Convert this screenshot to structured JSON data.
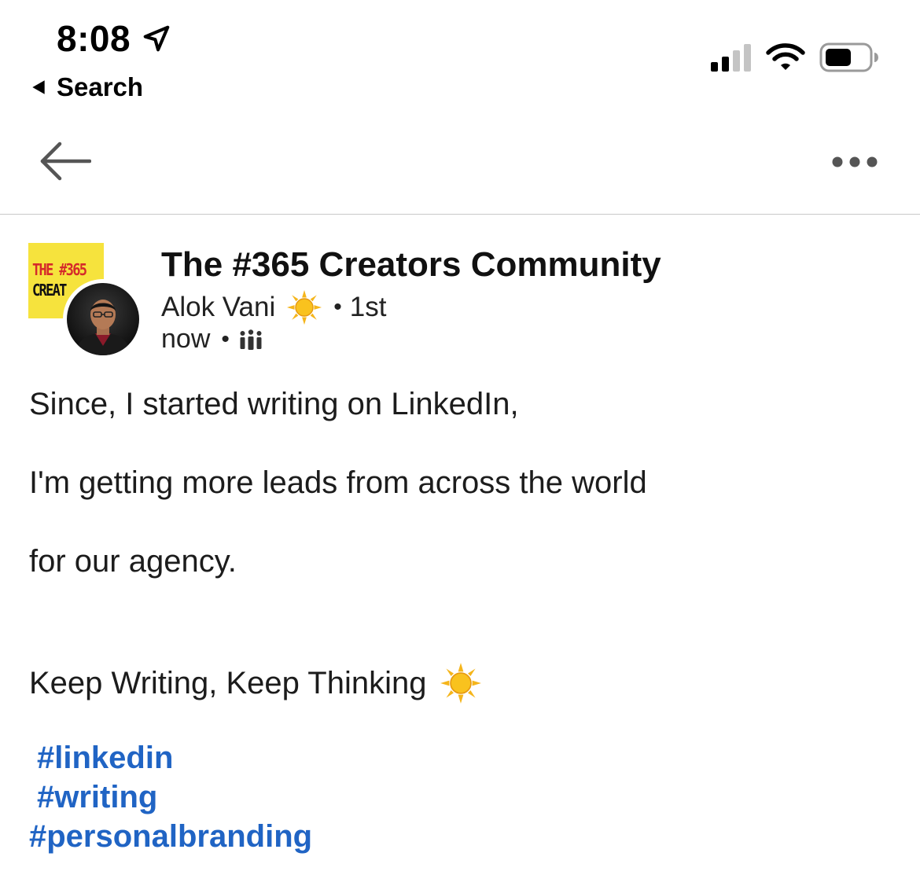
{
  "status_bar": {
    "time": "8:08",
    "back_label": "Search"
  },
  "icons": {
    "location": "location-arrow-icon",
    "signal": "cellular-signal-icon",
    "wifi": "wifi-icon",
    "battery": "battery-icon",
    "back": "back-arrow-icon",
    "more": "more-options-icon",
    "sun": "sun-emoji-icon",
    "audience": "group-audience-icon"
  },
  "header": {
    "group_name": "The #365 Creators Community",
    "group_logo_text": [
      "THE #365",
      "CREAT"
    ],
    "author": "Alok Vani",
    "connection": "1st",
    "time": "now"
  },
  "post": {
    "lines": [
      "Since, I started writing on LinkedIn,",
      "I'm getting more leads from across the world",
      "for our agency.",
      "Keep Writing, Keep Thinking"
    ],
    "hashtags": [
      "#linkedin",
      "#writing",
      "#personalbranding"
    ]
  },
  "colors": {
    "hashtag": "#2064c4",
    "logo_bg": "#f6e33d",
    "logo_accent": "#d52a2a"
  }
}
